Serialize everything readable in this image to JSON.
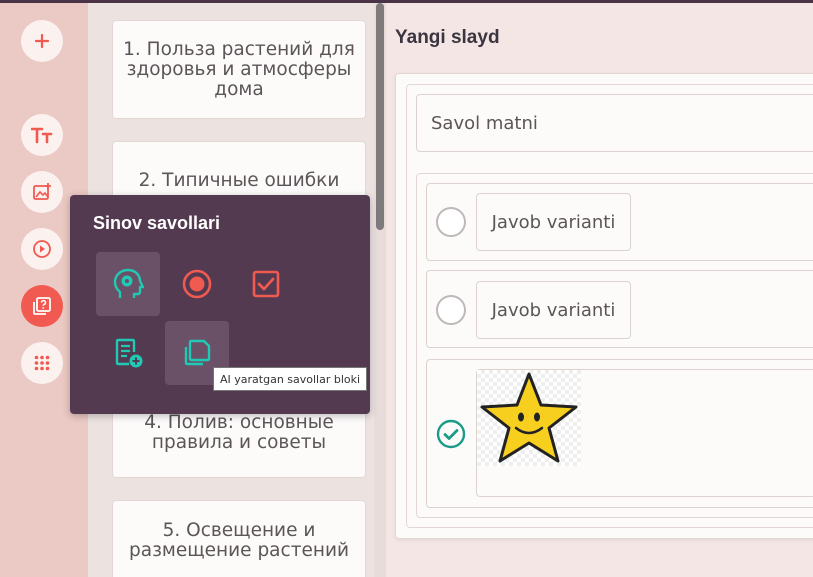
{
  "colors": {
    "accent": "#f05a50",
    "teal": "#1fc9b4",
    "popup_bg": "#533a50",
    "topbar": "#4a3347"
  },
  "rail": {
    "items": [
      {
        "name": "add",
        "icon": "plus-icon"
      },
      {
        "name": "text",
        "icon": "text-size-icon"
      },
      {
        "name": "image",
        "icon": "image-add-icon"
      },
      {
        "name": "video",
        "icon": "play-circle-icon"
      },
      {
        "name": "quiz",
        "icon": "quiz-icon",
        "active": true
      },
      {
        "name": "more",
        "icon": "grid-dots-icon"
      }
    ]
  },
  "slides": [
    {
      "label": "1. Польза растений для здоровья и атмосферы дома"
    },
    {
      "label": "2. Типичные ошибки"
    },
    {
      "label": "4. Полив: основные правила и советы"
    },
    {
      "label": "5. Освещение и размещение растений"
    }
  ],
  "editor": {
    "title": "Yangi slayd",
    "question_placeholder": "Savol matni",
    "answers": [
      {
        "text": "Javob varianti",
        "correct": false
      },
      {
        "text": "Javob varianti",
        "correct": false
      },
      {
        "image": "star-smiley-image",
        "correct": true
      }
    ]
  },
  "popup": {
    "title": "Sinov savollari",
    "buttons": [
      {
        "icon": "ai-head-icon"
      },
      {
        "icon": "single-choice-icon"
      },
      {
        "icon": "multiple-choice-icon"
      },
      {
        "icon": "add-question-list-icon"
      },
      {
        "icon": "copy-blocks-icon"
      }
    ],
    "tooltip": "AI yaratgan savollar bloki"
  }
}
